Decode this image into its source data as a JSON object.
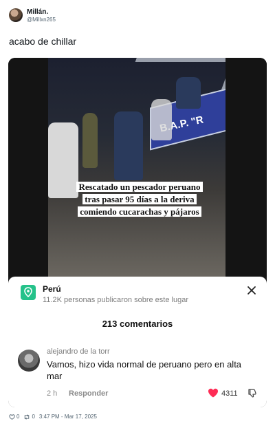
{
  "tweet": {
    "display_name": "Millán.",
    "handle": "@Millxn265",
    "text": "acabo de chillar",
    "likes": "0",
    "retweets": "0",
    "timestamp": "3:47 PM - Mar 17, 2025"
  },
  "video": {
    "banner_text": "B.A.P. \"R",
    "caption_lines": [
      "Rescatado un pescador peruano",
      "tras pasar 95 días a la deriva",
      "comiendo cucarachas y pájaros"
    ]
  },
  "location": {
    "title": "Perú",
    "subtitle": "11.2K personas publicaron sobre este lugar",
    "icon": "map-pin-icon"
  },
  "comments": {
    "count_label": "213 comentarios",
    "items": [
      {
        "user": "alejandro de la torr",
        "text": "Vamos, hizo vida normal de peruano pero en alta mar",
        "time": "2 h",
        "reply_label": "Responder",
        "likes": "4311"
      }
    ]
  },
  "colors": {
    "heart": "#fe2c55",
    "location_icon": "#25c28a",
    "banner": "#2f3f9a"
  }
}
